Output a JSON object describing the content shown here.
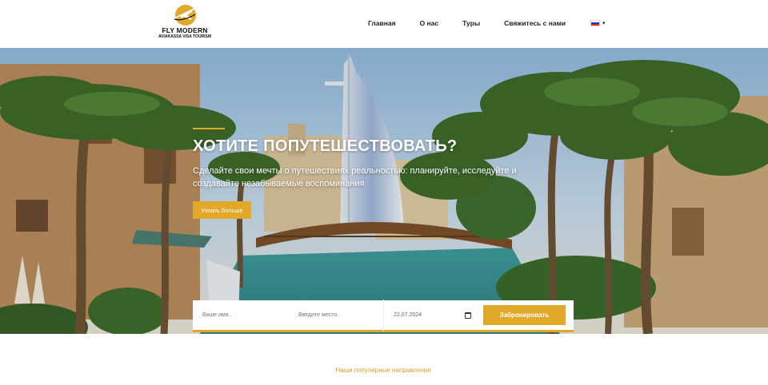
{
  "header": {
    "logo": {
      "title": "FLY MODERN",
      "subtitle": "AVIAKASSA VISA TOURISM",
      "icon": "airplane-logo-icon"
    },
    "nav": {
      "home": "Главная",
      "about": "О нас",
      "tours": "Туры",
      "contact": "Свяжитесь с нами"
    },
    "language": {
      "flag": "russia-flag-icon",
      "caret": "▾"
    }
  },
  "hero": {
    "title": "ХОТИТЕ ПОПУТЕШЕСТВОВАТЬ?",
    "text": "Сделайте свои мечты о путешествиях реальностью: планируйте, исследуйте и создавайте незабываемые воспоминания",
    "button": "Узнать больше"
  },
  "booking": {
    "name_placeholder": "Ваше имя..",
    "place_placeholder": "Введите место..",
    "date_value": "22.07.2024",
    "submit": "Забронировать"
  },
  "popular": {
    "label": "Наши популярные направления"
  },
  "colors": {
    "accent": "#e2a82a",
    "text": "#222222"
  }
}
